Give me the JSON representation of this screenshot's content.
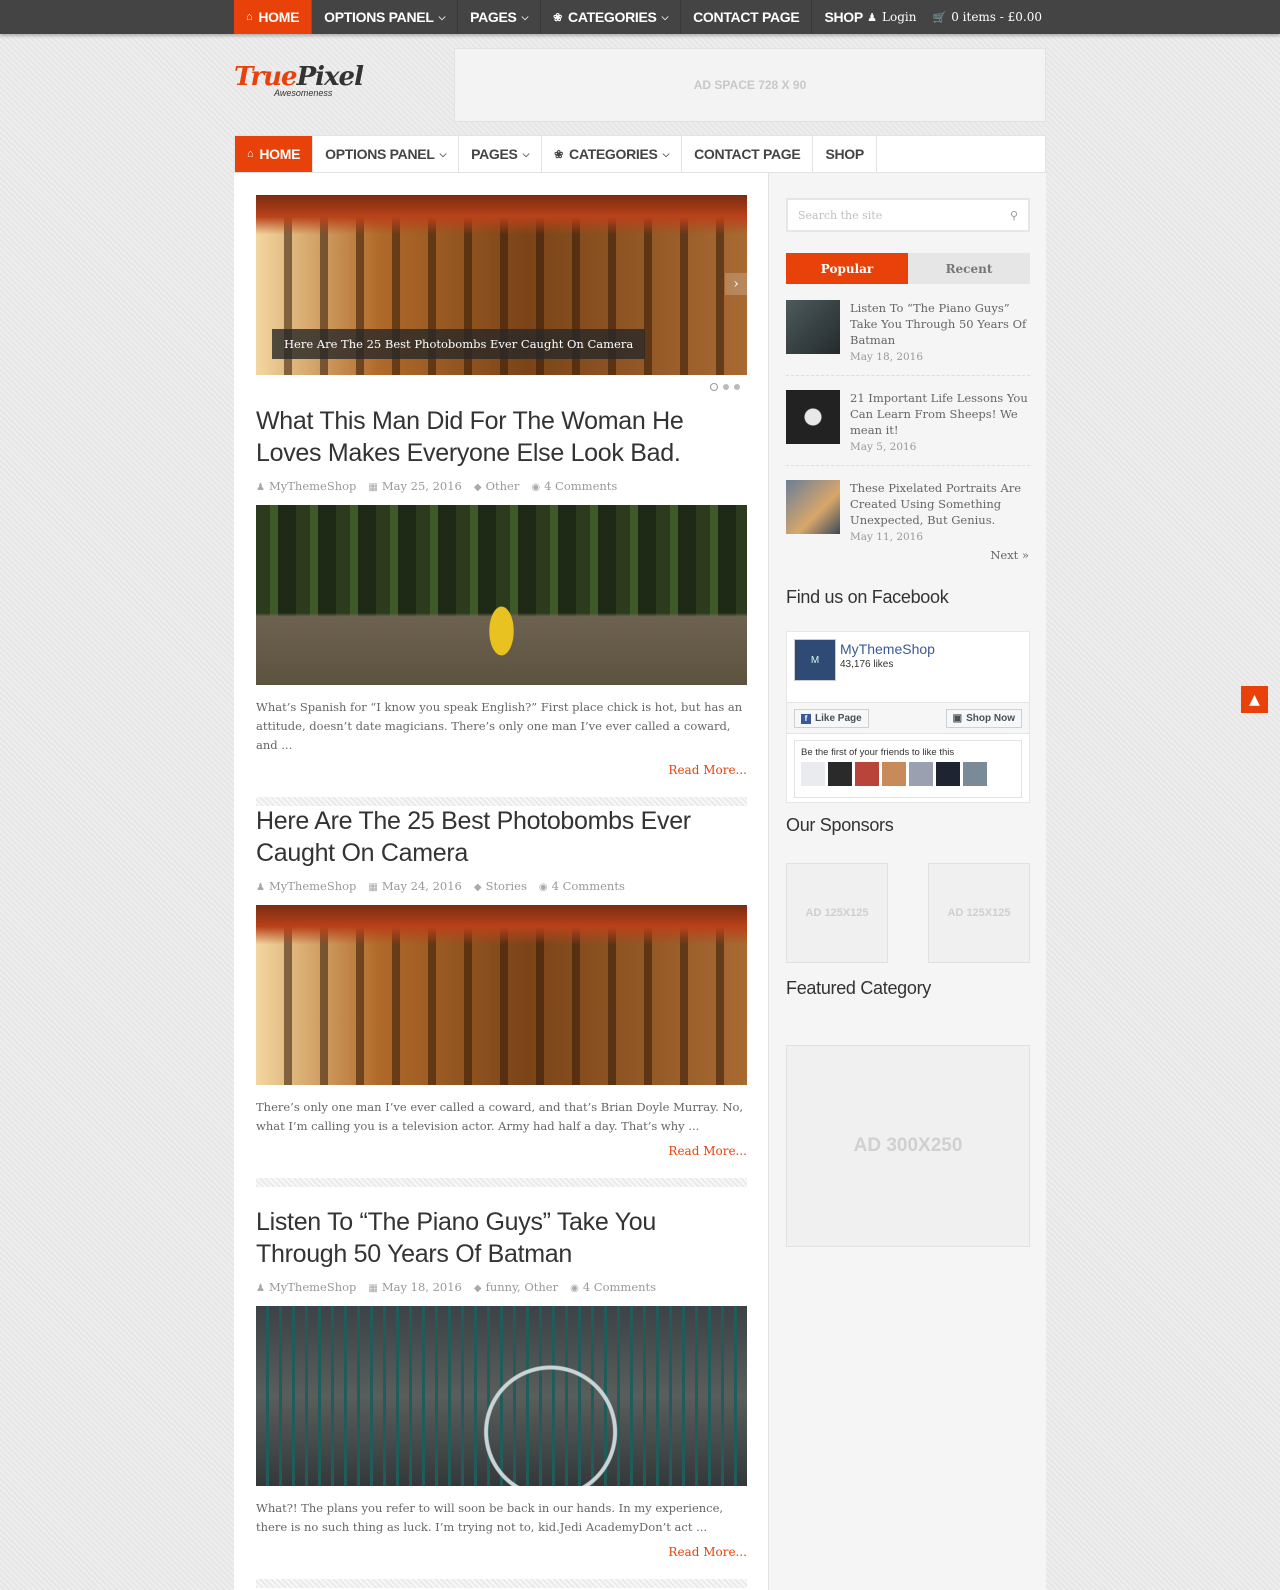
{
  "nav": {
    "home": "Home",
    "options": "Options Panel",
    "pages": "Pages",
    "categories": "Categories",
    "contact": "Contact Page",
    "shop": "Shop"
  },
  "topbar": {
    "login": "Login",
    "cart": "0 items - £0.00"
  },
  "header": {
    "logo_part1": "True",
    "logo_part2": "Pixel",
    "tagline": "Awesomeness",
    "ad_banner": "AD SPACE 728 X 90"
  },
  "slider": {
    "caption": "Here Are The 25 Best Photobombs Ever Caught On Camera",
    "slide_count": 3,
    "active_slide": 1
  },
  "posts": [
    {
      "title": "What This Man Did For The Woman He Loves Makes Everyone Else Look Bad.",
      "author": "MyThemeShop",
      "date": "May 25, 2016",
      "category": "Other",
      "comments": "4 Comments",
      "excerpt": "What’s Spanish for “I know you speak English?” First place chick is hot, but has an attitude, doesn’t date magicians. There’s only one man I’ve ever called a coward, and ...",
      "read_more": "Read More..."
    },
    {
      "title": "Here Are The 25 Best Photobombs Ever Caught On Camera",
      "author": "MyThemeShop",
      "date": "May 24, 2016",
      "category": "Stories",
      "comments": "4 Comments",
      "excerpt": "There’s only one man I’ve ever called a coward, and that’s Brian Doyle Murray. No, what I’m calling you is a television actor. Army had half a day. That’s why ...",
      "read_more": "Read More..."
    },
    {
      "title": "Listen To “The Piano Guys” Take You Through 50 Years Of Batman",
      "author": "MyThemeShop",
      "date": "May 18, 2016",
      "category": "funny, Other",
      "comments": "4 Comments",
      "excerpt": "What?! The plans you refer to will soon be back in our hands. In my experience, there is no such thing as luck. I’m trying not to, kid.Jedi AcademyDon’t act ...",
      "read_more": "Read More..."
    }
  ],
  "sidebar": {
    "search_placeholder": "Search the site",
    "tab_popular": "Popular",
    "tab_recent": "Recent",
    "popular": [
      {
        "title": "Listen To “The Piano Guys” Take You Through 50 Years Of Batman",
        "date": "May 18, 2016"
      },
      {
        "title": "21 Important Life Lessons You Can Learn From Sheeps! We mean it!",
        "date": "May 5, 2016"
      },
      {
        "title": "These Pixelated Portraits Are Created Using Something Unexpected, But Genius.",
        "date": "May 11, 2016"
      }
    ],
    "next": "Next »",
    "facebook_title": "Find us on Facebook",
    "fb_page_name": "MyThemeShop",
    "fb_likes": "43,176 likes",
    "fb_like_btn": "Like Page",
    "fb_shop_btn": "Shop Now",
    "fb_friends_text": "Be the first of your friends to like this",
    "sponsors_title": "Our Sponsors",
    "ad125_1": "AD 125X125",
    "ad125_2": "AD 125X125",
    "featured_title": "Featured Category",
    "ad300": "AD 300X250"
  },
  "colors": {
    "accent": "#e8420a",
    "topbar": "#444444"
  },
  "icons": {
    "home": "home-icon",
    "leaf": "leaf-icon",
    "user": "user-icon",
    "cart": "cart-icon",
    "search": "search-icon",
    "to_top": "chevron-up-icon"
  }
}
